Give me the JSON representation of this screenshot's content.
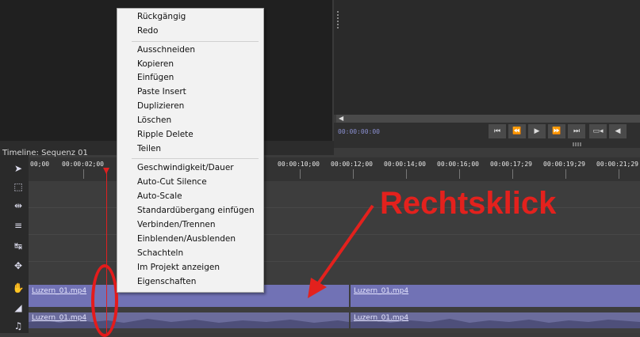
{
  "program_monitor": {
    "timecode": "00:00:00:00",
    "scroll_arrow": "◀",
    "transport": {
      "go_start": "⏮",
      "rewind": "⏪",
      "play": "▶",
      "fast_forward": "⏩",
      "go_end": "⏭",
      "camera": "▭◂",
      "audio": "◀"
    }
  },
  "timeline": {
    "title": "Timeline: Sequenz 01",
    "ruler_labels": [
      "00;00",
      "00:00:02;00",
      "00:00:10;00",
      "00:00:12;00",
      "00:00:14;00",
      "00:00:16;00",
      "00:00:17;29",
      "00:00:19;29",
      "00:00:21;29"
    ],
    "tools": [
      "pointer-tool",
      "marquee-tool",
      "ripple-tool",
      "roll-tool",
      "slip-tool",
      "slide-tool",
      "hand-tool",
      "zoom-tool",
      "audio-tool"
    ],
    "tool_glyphs": [
      "➤",
      "⬚",
      "⇹",
      "≡",
      "↹",
      "✥",
      "✋",
      "◢",
      "♫"
    ],
    "video_clips": [
      {
        "name": "Luzern_01.mp4"
      },
      {
        "name": "Luzern_01.mp4"
      }
    ],
    "audio_clips": [
      {
        "name": "Luzern_01.mp4"
      },
      {
        "name": "Luzern_01.mp4"
      }
    ],
    "playhead_color": "#e02020"
  },
  "context_menu": {
    "items": [
      "Rückgängig",
      "Redo",
      "Ausschneiden",
      "Kopieren",
      "Einfügen",
      "Paste Insert",
      "Duplizieren",
      "Löschen",
      "Ripple Delete",
      "Teilen",
      "Geschwindigkeit/Dauer",
      "Auto-Cut Silence",
      "Auto-Scale",
      "Standardübergang einfügen",
      "Verbinden/Trennen",
      "Einblenden/Ausblenden",
      "Schachteln",
      "Im Projekt anzeigen",
      "Eigenschaften"
    ]
  },
  "annotation": {
    "label": "Rechtsklick",
    "color": "#e3211d"
  },
  "colors": {
    "clip_video": "#7172b5",
    "clip_audio": "#6b6c9c",
    "menu_bg": "#f2f2f2"
  }
}
